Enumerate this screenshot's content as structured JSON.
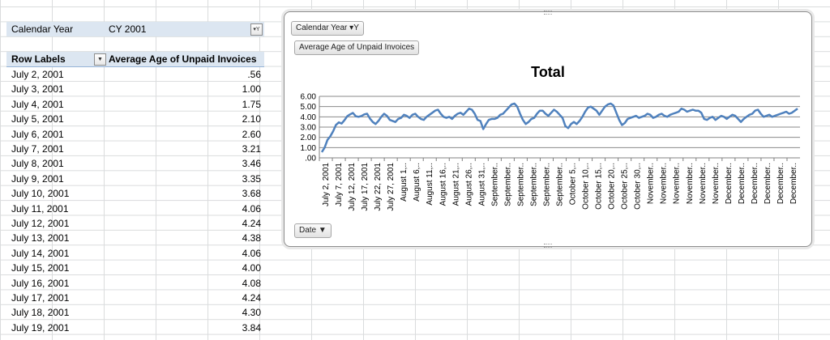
{
  "pivot": {
    "filter_field": "Calendar Year",
    "filter_value": "CY 2001",
    "row_labels_header": "Row Labels",
    "value_header": "Average Age of Unpaid Invoices",
    "rows": [
      {
        "label": "July 2, 2001",
        "value": ".56"
      },
      {
        "label": "July 3, 2001",
        "value": "1.00"
      },
      {
        "label": "July 4, 2001",
        "value": "1.75"
      },
      {
        "label": "July 5, 2001",
        "value": "2.10"
      },
      {
        "label": "July 6, 2001",
        "value": "2.60"
      },
      {
        "label": "July 7, 2001",
        "value": "3.21"
      },
      {
        "label": "July 8, 2001",
        "value": "3.46"
      },
      {
        "label": "July 9, 2001",
        "value": "3.35"
      },
      {
        "label": "July 10, 2001",
        "value": "3.68"
      },
      {
        "label": "July 11, 2001",
        "value": "4.06"
      },
      {
        "label": "July 12, 2001",
        "value": "4.24"
      },
      {
        "label": "July 13, 2001",
        "value": "4.38"
      },
      {
        "label": "July 14, 2001",
        "value": "4.06"
      },
      {
        "label": "July 15, 2001",
        "value": "4.00"
      },
      {
        "label": "July 16, 2001",
        "value": "4.08"
      },
      {
        "label": "July 17, 2001",
        "value": "4.24"
      },
      {
        "label": "July 18, 2001",
        "value": "4.30"
      },
      {
        "label": "July 19, 2001",
        "value": "3.84"
      }
    ]
  },
  "chart_buttons": {
    "filter_button": "Calendar Year",
    "value_button": "Average Age of Unpaid Invoices",
    "axis_button": "Date"
  },
  "chart_data": {
    "type": "line",
    "title": "Total",
    "xlabel": "",
    "ylabel": "",
    "ylim": [
      0,
      6
    ],
    "yticks": [
      ".00",
      "1.00",
      "2.00",
      "3.00",
      "4.00",
      "5.00",
      "6.00"
    ],
    "grid": true,
    "line_color": "#4f81bd",
    "x_tick_labels": [
      "July 2, 2001",
      "July 7, 2001",
      "July 12, 2001",
      "July 17, 2001",
      "July 22, 2001",
      "July 27, 2001",
      "August 1,..",
      "August 6,..",
      "August 11,..",
      "August 16,..",
      "August 21,..",
      "August 26,..",
      "August 31,..",
      "September..",
      "September..",
      "September..",
      "September..",
      "September..",
      "September..",
      "October 5,..",
      "October 10,..",
      "October 15,..",
      "October 20,..",
      "October 25,..",
      "October 30,..",
      "November..",
      "November..",
      "November..",
      "November..",
      "November..",
      "November..",
      "December..",
      "December..",
      "December..",
      "December..",
      "December..",
      "December.."
    ],
    "values": [
      0.56,
      1.0,
      1.75,
      2.1,
      2.6,
      3.21,
      3.46,
      3.35,
      3.68,
      4.06,
      4.24,
      4.38,
      4.06,
      4.0,
      4.08,
      4.24,
      4.3,
      3.84,
      3.5,
      3.3,
      3.6,
      4.0,
      4.3,
      4.1,
      3.7,
      3.6,
      3.5,
      3.8,
      3.9,
      4.2,
      4.1,
      3.9,
      4.2,
      4.3,
      4.0,
      3.8,
      3.7,
      4.0,
      4.2,
      4.4,
      4.6,
      4.7,
      4.3,
      4.0,
      3.9,
      4.0,
      3.8,
      4.1,
      4.3,
      4.4,
      4.2,
      4.5,
      4.8,
      4.7,
      4.3,
      3.7,
      3.6,
      2.8,
      3.3,
      3.7,
      3.8,
      3.8,
      3.9,
      4.2,
      4.3,
      4.6,
      4.9,
      5.2,
      5.3,
      5.0,
      4.3,
      3.7,
      3.3,
      3.5,
      3.8,
      3.9,
      4.3,
      4.6,
      4.6,
      4.3,
      4.1,
      4.4,
      4.7,
      4.5,
      4.2,
      3.9,
      3.1,
      2.9,
      3.3,
      3.5,
      3.3,
      3.6,
      4.0,
      4.5,
      4.9,
      5.0,
      4.8,
      4.6,
      4.2,
      4.6,
      5.0,
      5.2,
      5.3,
      5.1,
      4.4,
      3.7,
      3.2,
      3.4,
      3.8,
      3.9,
      4.0,
      4.1,
      3.9,
      4.0,
      4.1,
      4.3,
      4.2,
      3.9,
      4.0,
      4.2,
      4.3,
      4.1,
      4.0,
      4.2,
      4.3,
      4.4,
      4.5,
      4.8,
      4.7,
      4.5,
      4.6,
      4.7,
      4.6,
      4.6,
      4.4,
      3.8,
      3.7,
      3.9,
      4.0,
      3.7,
      3.9,
      4.1,
      4.0,
      3.8,
      4.0,
      4.2,
      4.1,
      3.8,
      3.5,
      3.8,
      4.0,
      4.2,
      4.3,
      4.6,
      4.7,
      4.3,
      4.0,
      4.1,
      4.2,
      4.0,
      4.1,
      4.2,
      4.3,
      4.4,
      4.5,
      4.3,
      4.4,
      4.6,
      4.8
    ]
  }
}
